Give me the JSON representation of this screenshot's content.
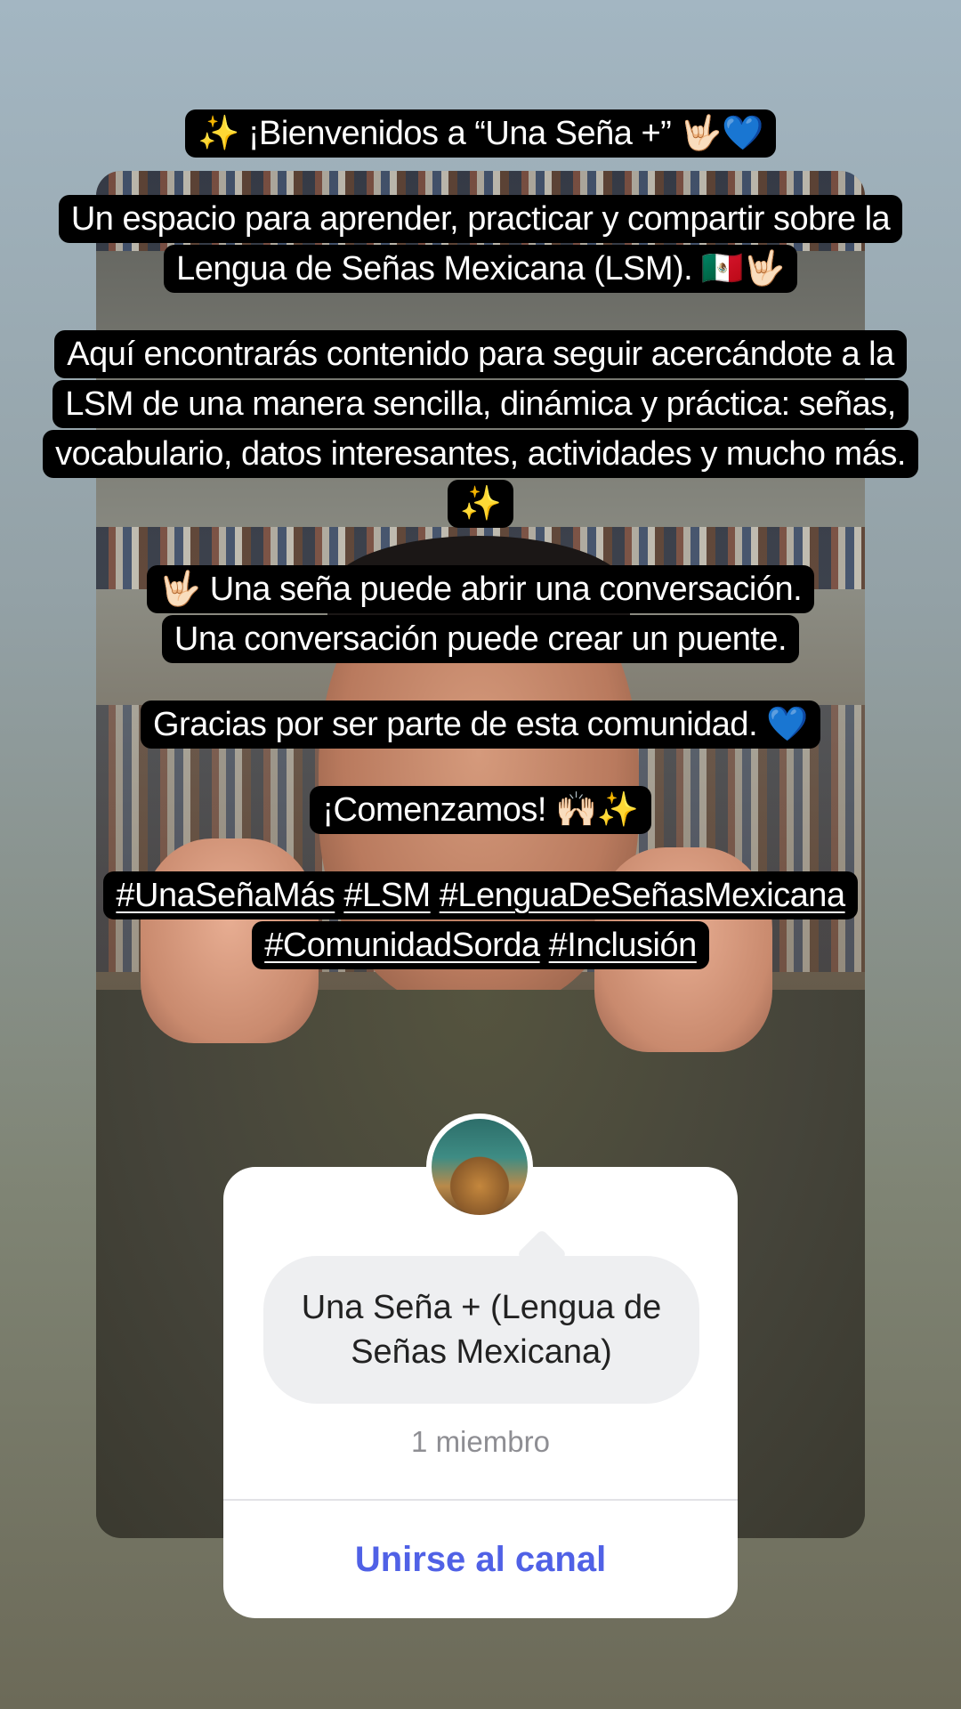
{
  "captions": {
    "block1": "✨ ¡Bienvenidos a “Una Seña +” 🤟🏻💙",
    "block2_line1": "Un espacio para aprender, practicar y compartir sobre la",
    "block2_line2": "Lengua de Señas Mexicana (LSM). 🇲🇽🤟🏻",
    "block3_line1": "Aquí encontrarás contenido para seguir acercándote a la",
    "block3_line2": "LSM de una manera sencilla, dinámica y práctica: señas,",
    "block3_line3": "vocabulario, datos interesantes, actividades y mucho más.",
    "block3_line4": "✨",
    "block4_line1": "🤟🏻 Una seña puede abrir una conversación.",
    "block4_line2": "Una conversación puede crear un puente.",
    "block5": "Gracias por ser parte de esta comunidad. 💙",
    "block6": "¡Comenzamos! 🙌🏻✨",
    "hashtags_line1": [
      "#UnaSeñaMás",
      "#LSM",
      "#LenguaDeSeñasMexicana"
    ],
    "hashtags_line2": [
      "#ComunidadSorda",
      "#Inclusión"
    ]
  },
  "channel_card": {
    "name": "Una Seña + (Lengua de Señas Mexicana)",
    "members": "1 miembro",
    "join_label": "Unirse al canal"
  },
  "colors": {
    "join_link": "#5061e6",
    "caption_bg": "#000000"
  }
}
